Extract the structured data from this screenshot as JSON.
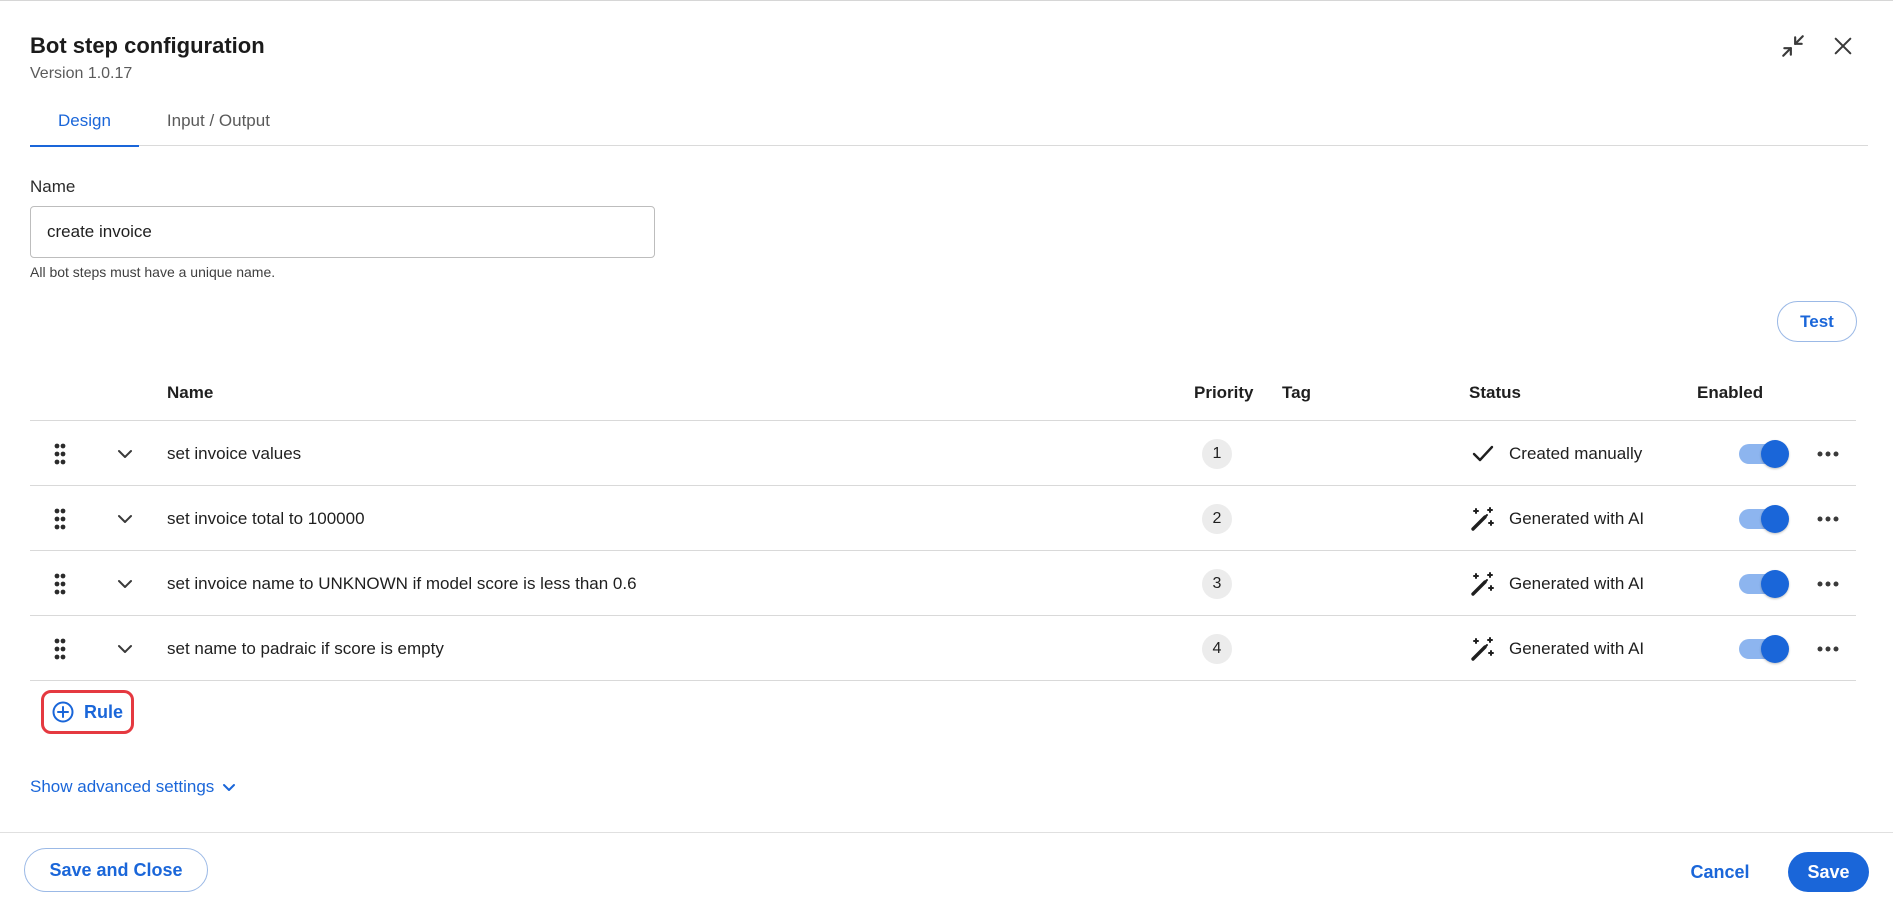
{
  "dialog": {
    "title": "Bot step configuration",
    "version": "Version 1.0.17"
  },
  "tabs": [
    {
      "label": "Design",
      "active": true
    },
    {
      "label": "Input / Output",
      "active": false
    }
  ],
  "name_field": {
    "label": "Name",
    "value": "create invoice",
    "hint": "All bot steps must have a unique name."
  },
  "test_button": "Test",
  "table": {
    "headers": {
      "name": "Name",
      "priority": "Priority",
      "tag": "Tag",
      "status": "Status",
      "enabled": "Enabled"
    },
    "rows": [
      {
        "name": "set invoice values",
        "priority": "1",
        "tag": "",
        "status": "Created manually",
        "status_icon": "check-icon",
        "enabled": true
      },
      {
        "name": "set invoice total to 100000",
        "priority": "2",
        "tag": "",
        "status": "Generated with AI",
        "status_icon": "magic-wand-icon",
        "enabled": true
      },
      {
        "name": "set invoice name to UNKNOWN if model score is less than 0.6",
        "priority": "3",
        "tag": "",
        "status": "Generated with AI",
        "status_icon": "magic-wand-icon",
        "enabled": true
      },
      {
        "name": "set name to padraic if score is empty",
        "priority": "4",
        "tag": "",
        "status": "Generated with AI",
        "status_icon": "magic-wand-icon",
        "enabled": true
      }
    ]
  },
  "add_rule_button": "Rule",
  "advanced_settings_link": "Show advanced settings",
  "footer": {
    "save_close": "Save and Close",
    "cancel": "Cancel",
    "save": "Save"
  },
  "colors": {
    "accent": "#1a66d9",
    "highlight": "#e53940"
  }
}
